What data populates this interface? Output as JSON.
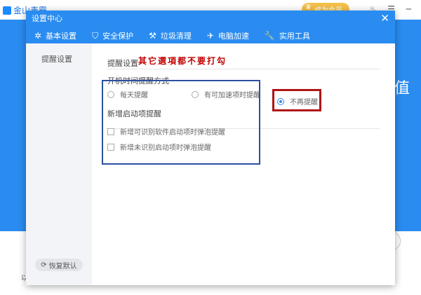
{
  "background": {
    "app_name": "金山毒霸",
    "vip_label": "成为会员",
    "big_char": "值",
    "left_char": "以"
  },
  "dialog": {
    "title": "设置中心",
    "close_glyph": "✕",
    "tabs": [
      {
        "label": "基本设置",
        "icon": "gear-icon",
        "glyph": "✲"
      },
      {
        "label": "安全保护",
        "icon": "shield-icon",
        "glyph": "⛉"
      },
      {
        "label": "垃圾清理",
        "icon": "broom-icon",
        "glyph": "⚒"
      },
      {
        "label": "电脑加速",
        "icon": "rocket-icon",
        "glyph": "✈"
      },
      {
        "label": "实用工具",
        "icon": "wrench-icon",
        "glyph": "🔧"
      }
    ],
    "active_tab": "电脑加速",
    "sidebar": {
      "items": [
        {
          "label": "提醒设置"
        }
      ],
      "restore_label": "恢复默认",
      "restore_glyph": "⟳"
    },
    "content": {
      "section_label": "提醒设置",
      "annotation": "其它選項都不要打勾",
      "startup_group": {
        "title": "开机时间提醒方式",
        "options": [
          {
            "label": "每天提醒",
            "selected": false
          },
          {
            "label": "有可加速项时提醒",
            "selected": false
          },
          {
            "label": "不再提醒",
            "selected": true
          }
        ]
      },
      "newitem_group": {
        "title": "新增启动项提醒",
        "options": [
          {
            "label": "新增可识别软件启动项时弹泡提醒",
            "checked": false
          },
          {
            "label": "新增未识别启动项时弹泡提醒",
            "checked": false
          }
        ]
      }
    }
  },
  "colors": {
    "accent": "#2a8cf0",
    "annotation_red": "#c00000",
    "highlight_blue_box": "#2b4fa0",
    "highlight_red_box": "#b01515"
  }
}
